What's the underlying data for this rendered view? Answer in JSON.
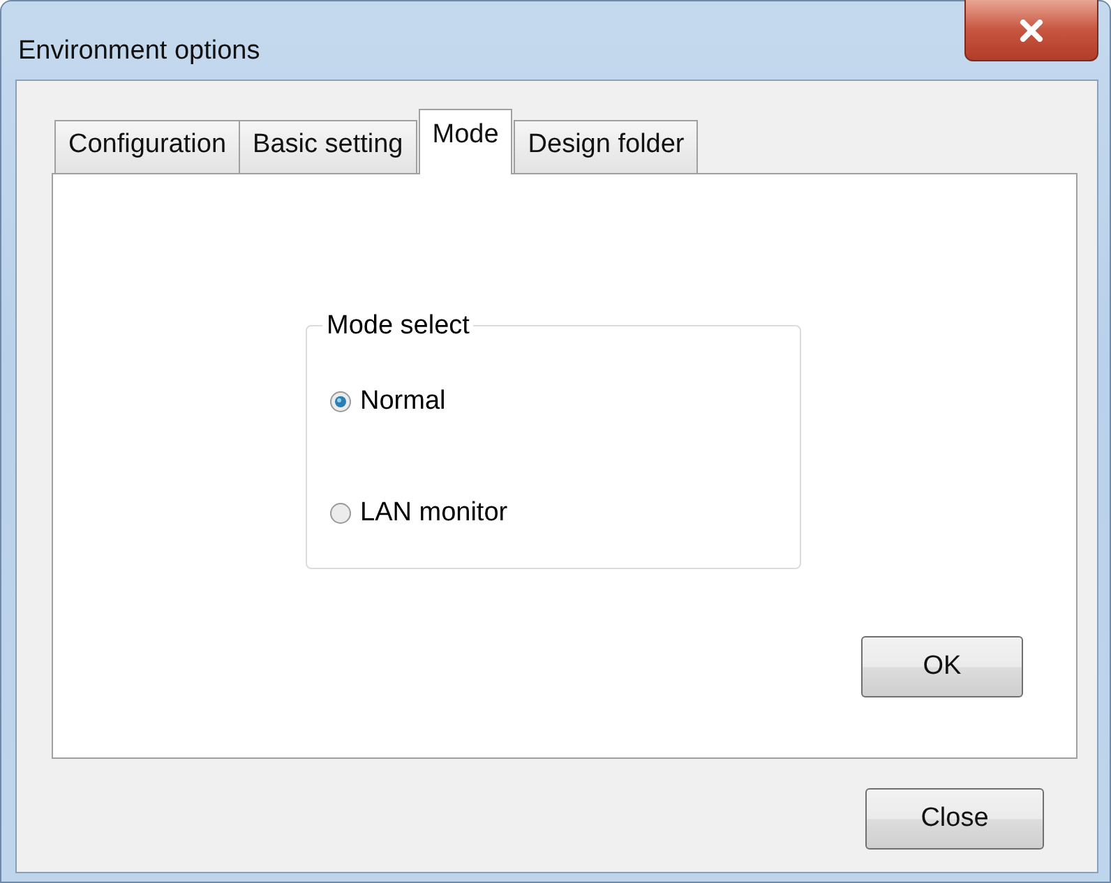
{
  "window": {
    "title": "Environment options"
  },
  "tabs": [
    {
      "label": "Configuration",
      "selected": false
    },
    {
      "label": "Basic setting",
      "selected": false
    },
    {
      "label": "Mode",
      "selected": true
    },
    {
      "label": "Design folder",
      "selected": false
    }
  ],
  "mode_group": {
    "title": "Mode select",
    "options": [
      {
        "label": "Normal",
        "selected": true
      },
      {
        "label": "LAN monitor",
        "selected": false
      }
    ]
  },
  "panel_button": "OK",
  "footer_button": "Close"
}
